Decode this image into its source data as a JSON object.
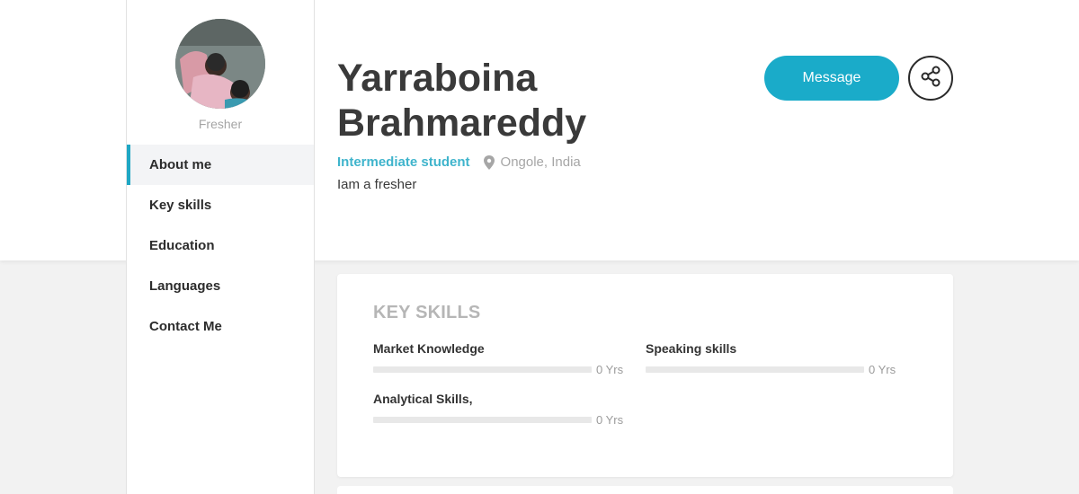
{
  "profile": {
    "role": "Fresher",
    "name": "Yarraboina Brahmareddy",
    "headline": "Intermediate student",
    "location": "Ongole, India",
    "about": "Iam a fresher"
  },
  "actions": {
    "message_label": "Message"
  },
  "sidebar": {
    "items": [
      {
        "label": "About me",
        "active": true
      },
      {
        "label": "Key skills",
        "active": false
      },
      {
        "label": "Education",
        "active": false
      },
      {
        "label": "Languages",
        "active": false
      },
      {
        "label": "Contact Me",
        "active": false
      }
    ]
  },
  "key_skills": {
    "title": "KEY SKILLS",
    "skills": [
      {
        "name": "Market Knowledge",
        "years": "0 Yrs",
        "level": 0
      },
      {
        "name": "Speaking skills",
        "years": "0 Yrs",
        "level": 0
      },
      {
        "name": "Analytical Skills,",
        "years": "0 Yrs",
        "level": 0
      }
    ]
  },
  "colors": {
    "accent": "#1aabc9",
    "headline": "#3fb4cc",
    "background": "#f2f2f2"
  },
  "icons": {
    "location": "map-pin-icon",
    "share": "share-icon"
  }
}
